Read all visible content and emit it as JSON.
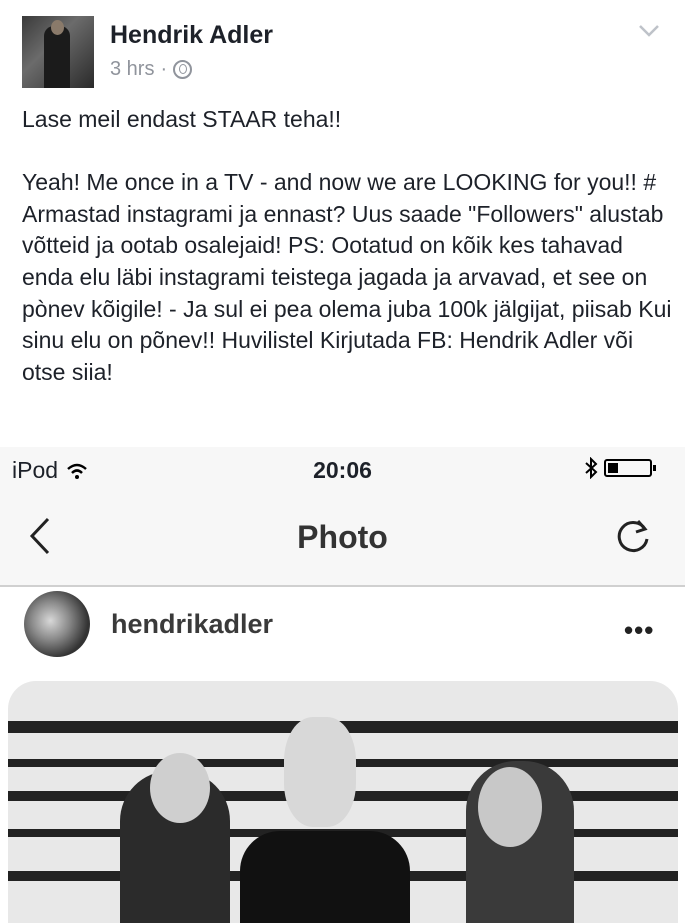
{
  "post": {
    "author": "Hendrik Adler",
    "time": "3 hrs",
    "separator": "·",
    "text": "Lase meil endast STAAR teha!!\n\nYeah! Me once in a TV - and now we are LOOKING for you!! #\nArmastad instagrami ja ennast? Uus saade \"Followers\" alustab võtteid ja ootab osalejaid! PS: Ootatud on kõik kes tahavad enda elu läbi instagrami teistega jagada ja arvavad, et see on pònev kõigile! - Ja sul ei pea olema juba 100k jälgijat, piisab Kui sinu elu on põnev!! Huvilistel Kirjutada FB: Hendrik Adler või otse siia!"
  },
  "screenshot": {
    "status": {
      "carrier": "iPod",
      "time": "20:06"
    },
    "nav": {
      "title": "Photo"
    },
    "instagram": {
      "username": "hendrikadler",
      "more": "•••"
    }
  },
  "icons": {
    "privacy": "globe-icon",
    "menu": "chevron-down-icon",
    "wifi": "wifi-icon",
    "bluetooth": "bluetooth-icon",
    "battery": "battery-icon",
    "back": "back-arrow-icon",
    "refresh": "refresh-icon"
  }
}
